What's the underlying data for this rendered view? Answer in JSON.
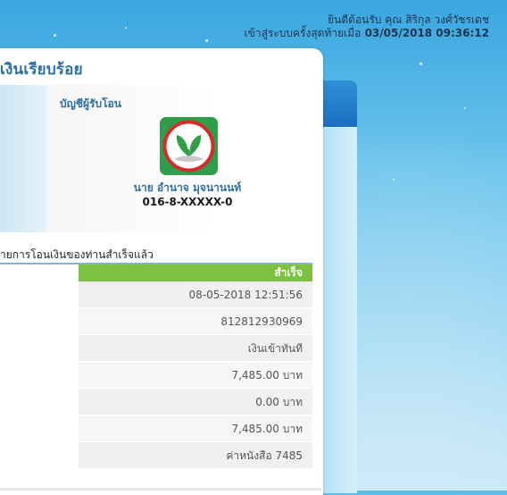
{
  "header": {
    "welcome": "ยินดีต้อนรับ คุณ สิริกุล วงศ์วัชรเดช",
    "last_login_label": "เข้าสู่ระบบครั้งสุดท้ายเมื่อ",
    "last_login_value": "03/05/2018 09:36:12"
  },
  "page": {
    "title": "เงินเรียบร้อย"
  },
  "destination": {
    "label": "บัญชีผู้รับโอน",
    "bank_icon": "kbank-leaf-icon",
    "account_name": "นาย อำนาจ มุจนานนท์",
    "account_number": "016-8-XXXXX-0"
  },
  "result": {
    "message": "ายการโอนเงินของท่านสำเร็จแล้ว",
    "status": "สำเร็จ",
    "rows": [
      "08-05-2018 12:51:56",
      "812812930969",
      "เงินเข้าทันที",
      "7,485.00 บาท",
      "0.00 บาท",
      "7,485.00 บาท",
      "ค่าหนังสือ 7485"
    ]
  },
  "colors": {
    "accent_blue": "#2d6ea3",
    "status_green": "#7dc142",
    "bank_green": "#2e9e4a"
  }
}
